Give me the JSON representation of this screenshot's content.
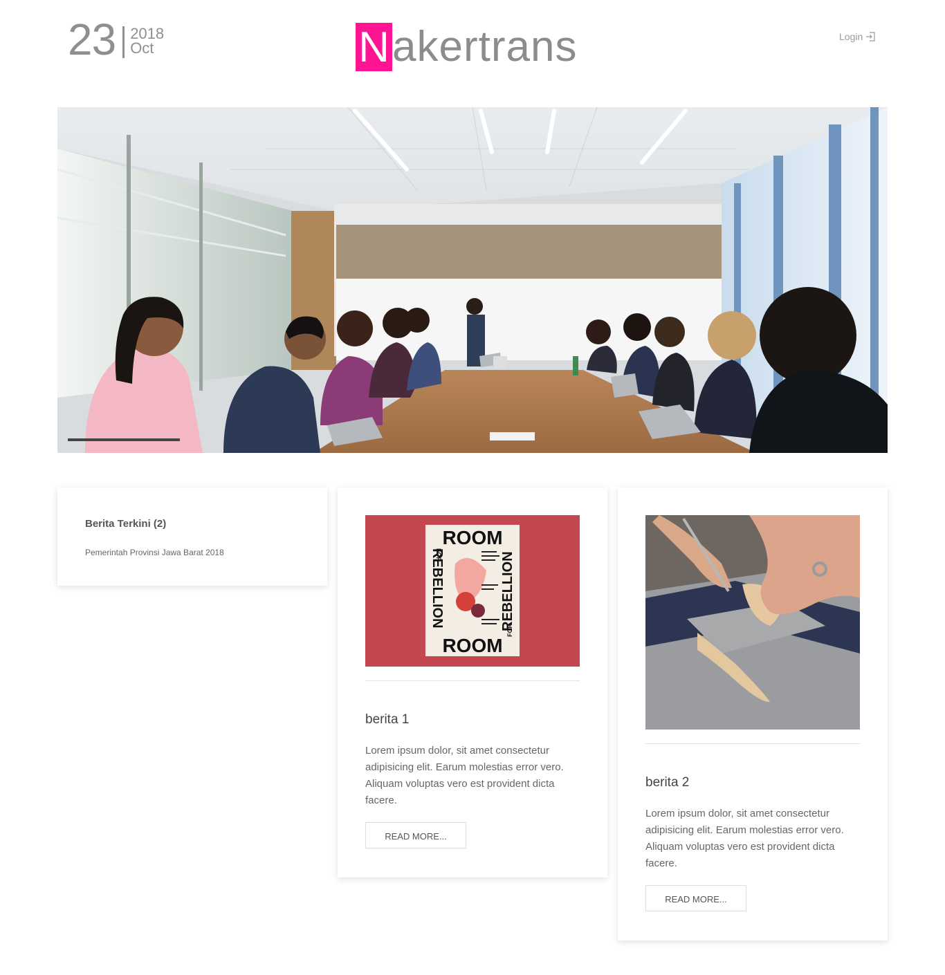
{
  "header": {
    "date_day": "23",
    "date_year": "2018",
    "date_month": "Oct",
    "brand_initial": "N",
    "brand_rest": "akertrans",
    "brand_color": "#ff1493",
    "login_label": "Login",
    "login_icon": "sign-in-icon"
  },
  "hero": {
    "image": "meeting-room-photo"
  },
  "info_card": {
    "title": "Berita Terkini (2)",
    "subtitle": "Pemerintah Provinsi Jawa Barat 2018"
  },
  "news": [
    {
      "image": "room-for-rebellion-poster",
      "poster_words": [
        "ROOM",
        "FOR",
        "REBELLION",
        "FOR",
        "REBELLION",
        "FOR",
        "ROOM"
      ],
      "title": "berita 1",
      "text": "Lorem ipsum dolor, sit amet consectetur adipisicing elit. Earum molestias error vero. Aliquam voluptas vero est provident dicta facere.",
      "button": "READ MORE..."
    },
    {
      "image": "leather-craft-photo",
      "title": "berita 2",
      "text": "Lorem ipsum dolor, sit amet consectetur adipisicing elit. Earum molestias error vero. Aliquam voluptas vero est provident dicta facere.",
      "button": "READ MORE..."
    }
  ]
}
